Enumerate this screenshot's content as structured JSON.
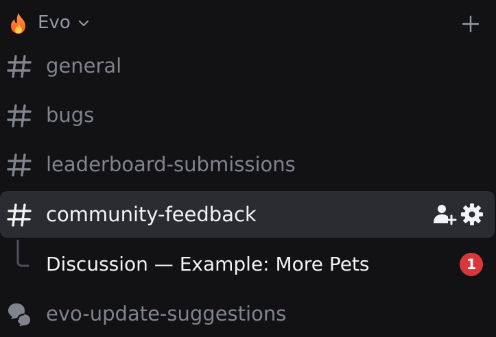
{
  "server": {
    "name": "Evo",
    "icon": "flame-icon",
    "add_icon": "plus-icon"
  },
  "channels": [
    {
      "name": "general",
      "icon": "hash-icon",
      "active": false
    },
    {
      "name": "bugs",
      "icon": "hash-icon",
      "active": false
    },
    {
      "name": "leaderboard-submissions",
      "icon": "hash-icon",
      "active": false
    },
    {
      "name": "community-feedback",
      "icon": "hash-icon",
      "active": true,
      "actions": [
        "invite-icon",
        "settings-icon"
      ]
    }
  ],
  "thread": {
    "name": "Discussion — Example: More Pets",
    "badge": "1"
  },
  "forum": {
    "name": "evo-update-suggestions",
    "icon": "forum-icon"
  },
  "colors": {
    "background": "#121214",
    "active_row": "#2b2c31",
    "muted_text": "#80848e",
    "bright_text": "#f2f3f5",
    "badge": "#da373c"
  }
}
